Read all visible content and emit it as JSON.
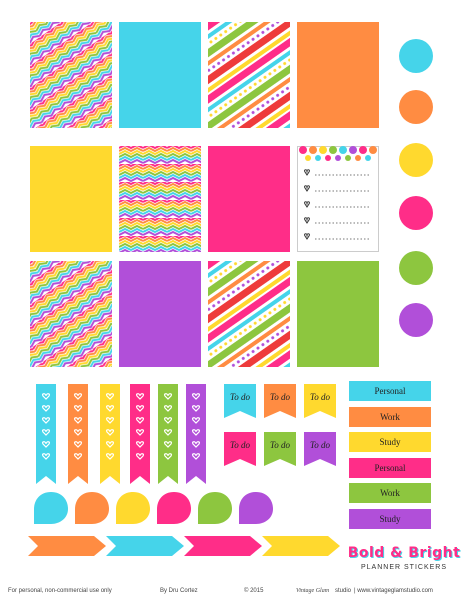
{
  "colors": {
    "cyan": "#45D4EA",
    "orange": "#FF8C42",
    "yellow": "#FFD92E",
    "pink": "#FF2D88",
    "green": "#8DC63F",
    "purple": "#B14FD9",
    "red": "#EE3B3B"
  },
  "todo_labels": [
    "To do",
    "To do",
    "To do",
    "To do",
    "To do",
    "To do"
  ],
  "labels": [
    "Personal",
    "Work",
    "Study",
    "Personal",
    "Work",
    "Study"
  ],
  "title": {
    "line1": "Bold & Bright",
    "line2": "PLANNER STICKERS"
  },
  "footer": {
    "usage": "For personal, non-commercial use only",
    "author": "By Dru Cortez",
    "copyright": "© 2015",
    "brand": "Vintage Glam",
    "brand_suffix": "studio",
    "url": "| www.vintageglamstudio.com"
  },
  "checklist_icon": "heart-icon",
  "flag_icon": "heart-icon"
}
